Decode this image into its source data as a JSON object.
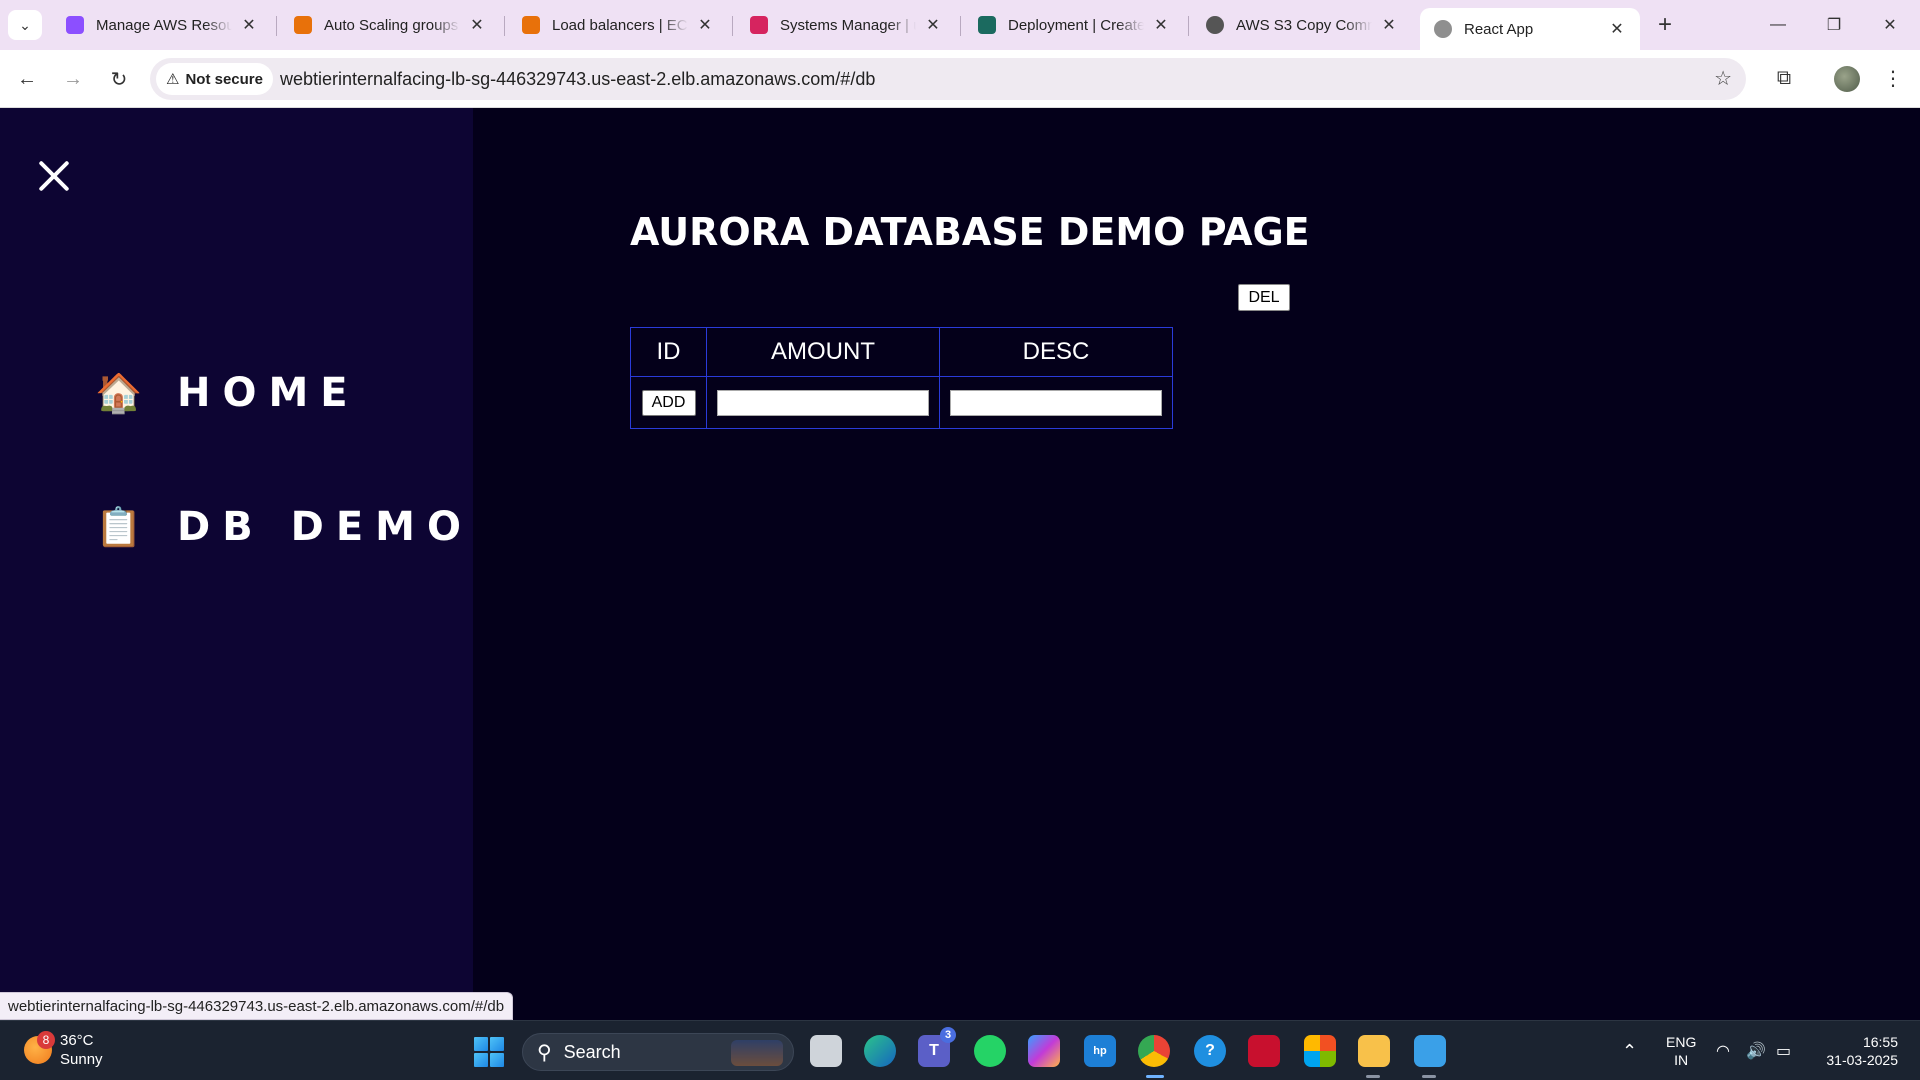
{
  "browser": {
    "tabs": [
      {
        "title": "Manage AWS Resour",
        "favicon_color": "#8c4fff"
      },
      {
        "title": "Auto Scaling groups",
        "favicon_color": "#e8710a"
      },
      {
        "title": "Load balancers | EC2",
        "favicon_color": "#e8710a"
      },
      {
        "title": "Systems Manager | u",
        "favicon_color": "#d6245f"
      },
      {
        "title": "Deployment | Create",
        "favicon_color": "#1b6a5f"
      },
      {
        "title": "AWS S3 Copy Comm",
        "favicon_color": "#555555"
      },
      {
        "title": "React App",
        "favicon_color": "#8f8f8f",
        "active": true
      }
    ],
    "tab_close_glyph": "✕",
    "new_tab_glyph": "+",
    "security_label": "Not secure",
    "url": "webtierinternalfacing-lb-sg-446329743.us-east-2.elb.amazonaws.com/#/db",
    "status_url": "webtierinternalfacing-lb-sg-446329743.us-east-2.elb.amazonaws.com/#/db"
  },
  "sidebar": {
    "items": [
      {
        "emoji": "🏠",
        "label": "HOME"
      },
      {
        "emoji": "📋",
        "label": "DB DEMO"
      }
    ]
  },
  "main": {
    "title": "AURORA DATABASE DEMO PAGE",
    "del_label": "DEL",
    "table": {
      "headers": [
        "ID",
        "AMOUNT",
        "DESC"
      ],
      "add_label": "ADD",
      "amount_value": "",
      "desc_value": ""
    }
  },
  "taskbar": {
    "weather_badge": "8",
    "temperature": "36°C",
    "condition": "Sunny",
    "search_label": "Search",
    "teams_badge": "3",
    "lang_line1": "ENG",
    "lang_line2": "IN",
    "time": "16:55",
    "date": "31-03-2025"
  },
  "colors": {
    "sidebar_bg": "#0d0533",
    "main_bg": "#04001a",
    "table_border": "#2a3bd9"
  }
}
